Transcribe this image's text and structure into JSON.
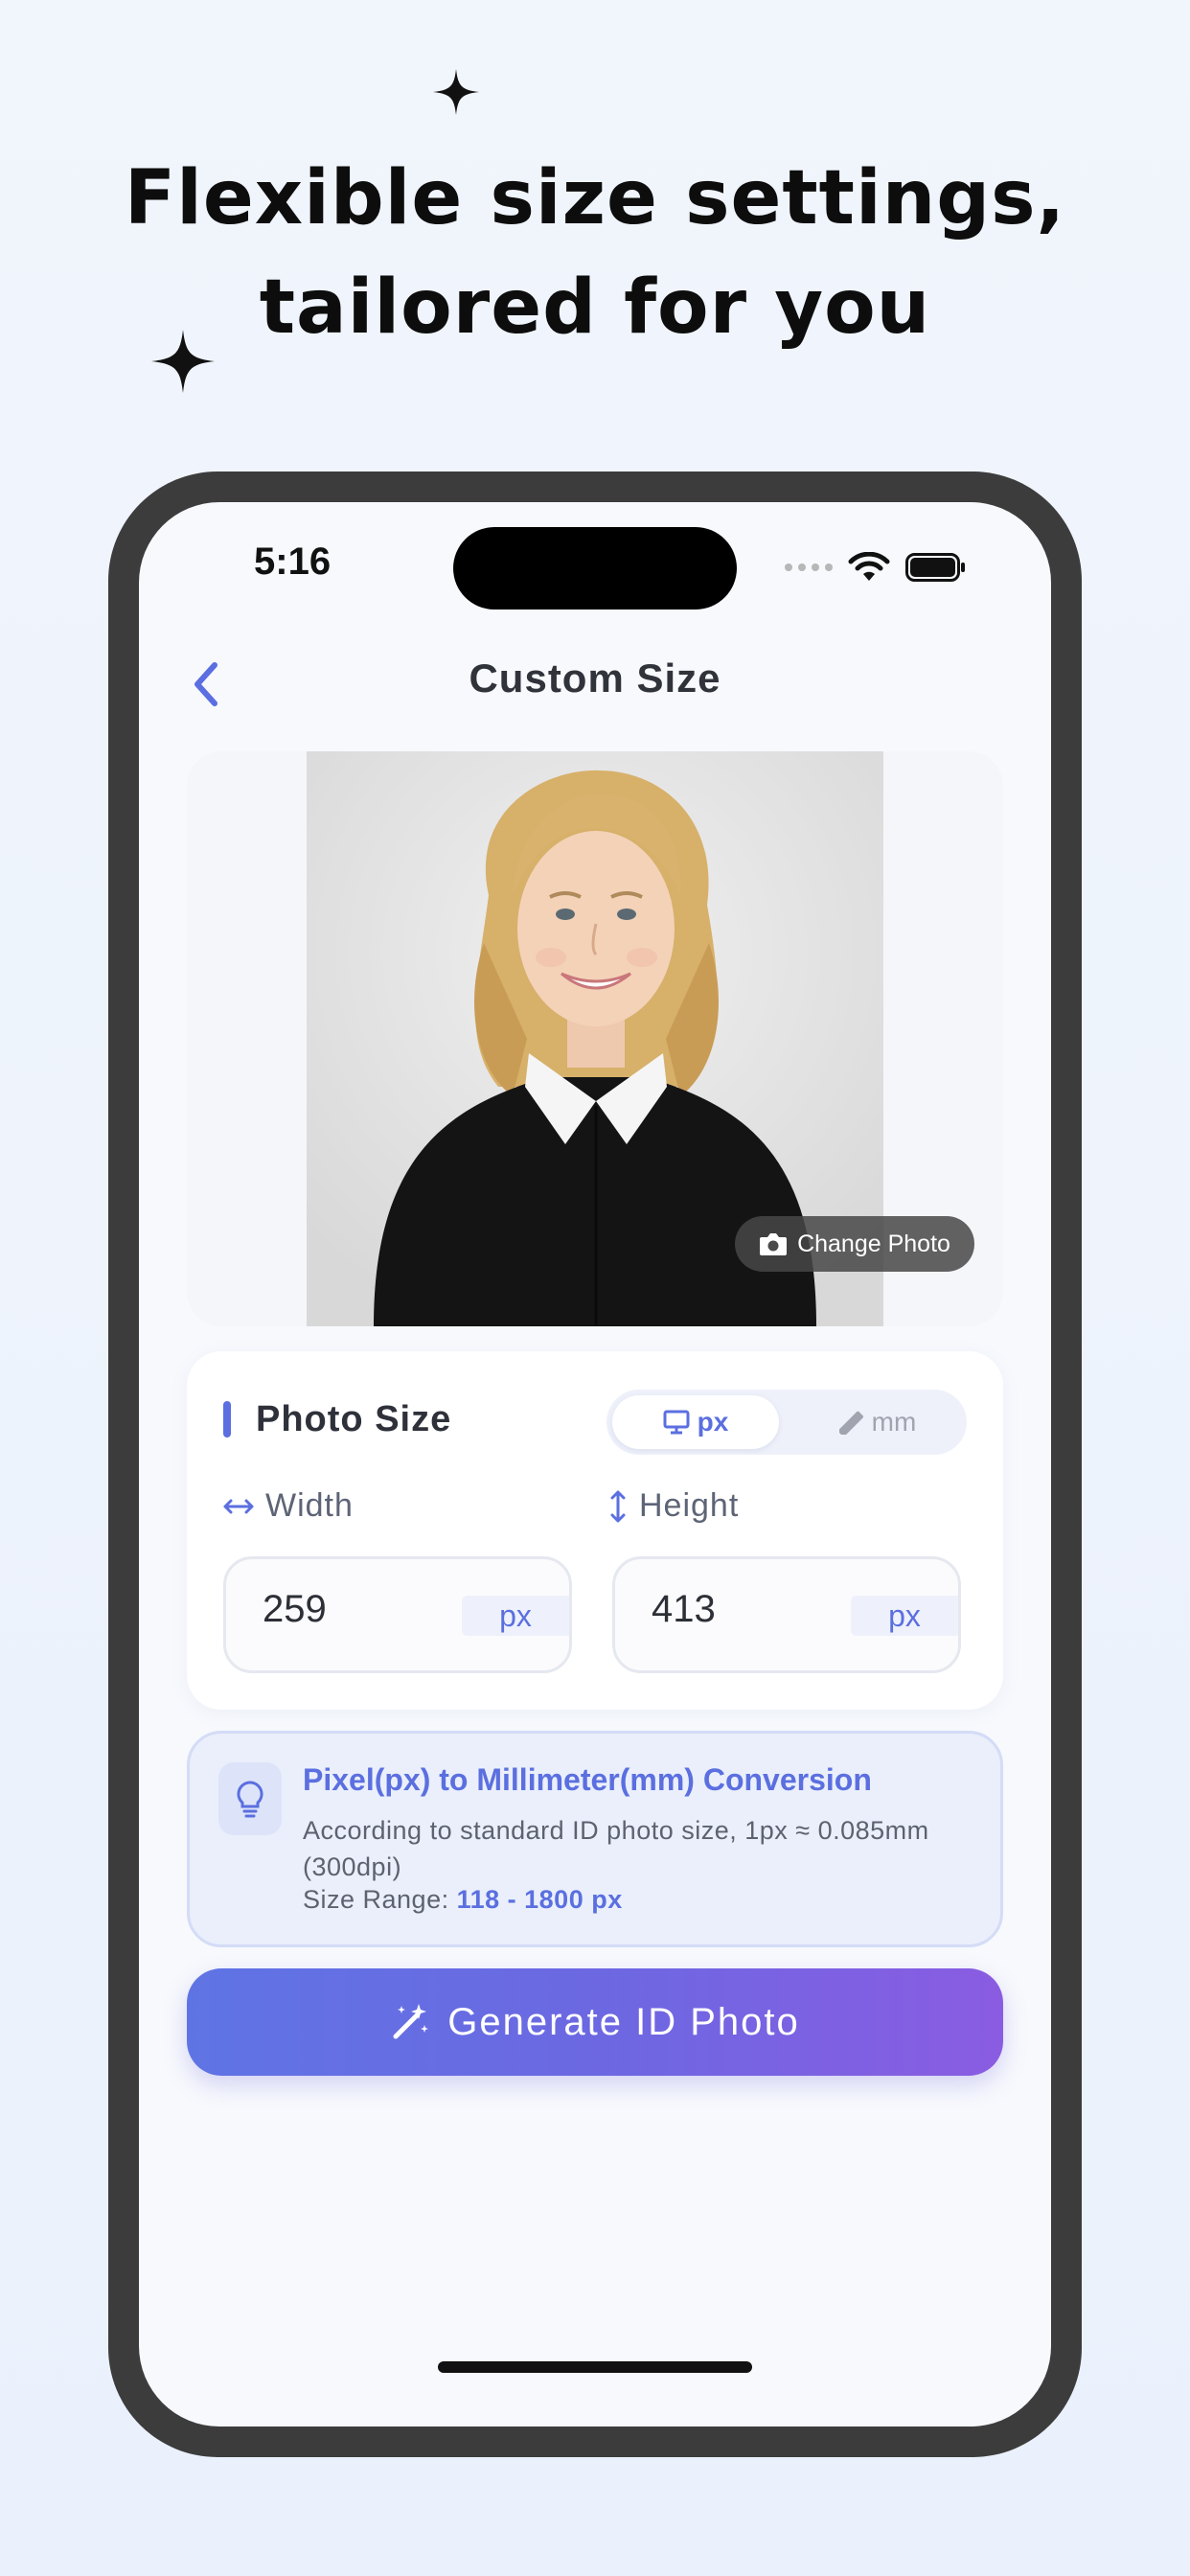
{
  "headline": {
    "line1": "Flexible size settings,",
    "line2": "tailored for you"
  },
  "status_bar": {
    "time": "5:16"
  },
  "nav": {
    "title": "Custom Size",
    "back_icon": "chevron-left-icon"
  },
  "photo": {
    "change_label": "Change Photo",
    "change_icon": "camera-icon"
  },
  "photo_size": {
    "title": "Photo Size",
    "units": {
      "px_label": "px",
      "mm_label": "mm",
      "selected": "px"
    },
    "width": {
      "label": "Width",
      "value": "259",
      "unit": "px"
    },
    "height": {
      "label": "Height",
      "value": "413",
      "unit": "px"
    }
  },
  "info": {
    "title": "Pixel(px) to Millimeter(mm) Conversion",
    "text": "According to standard ID photo size, 1px ≈ 0.085mm (300dpi)",
    "range_label": "Size Range: ",
    "range_value": "118 - 1800 px"
  },
  "generate": {
    "label": "Generate ID Photo",
    "icon": "magic-wand-icon"
  },
  "colors": {
    "accent": "#5b6fe0",
    "gradient_start": "#5f74e4",
    "gradient_end": "#8a5ce2"
  }
}
